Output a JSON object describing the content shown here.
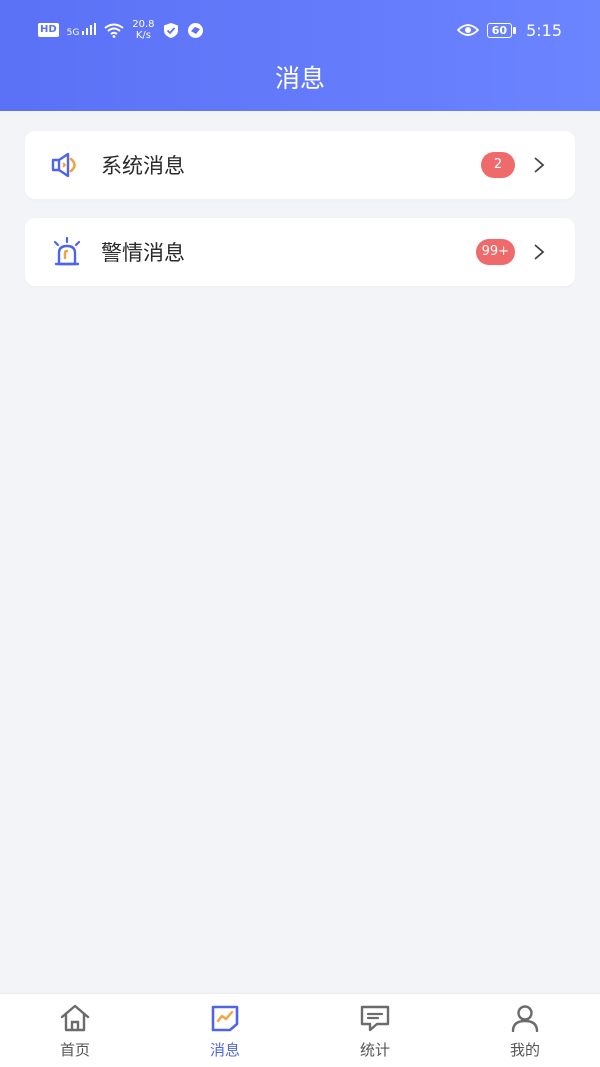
{
  "status_bar": {
    "hd": "HD",
    "signal_label": "5G",
    "net_speed_value": "20.8",
    "net_speed_unit": "K/s",
    "battery": "60",
    "time": "5:15"
  },
  "header": {
    "title": "消息"
  },
  "messages": [
    {
      "label": "系统消息",
      "badge": "2",
      "icon": "megaphone-icon"
    },
    {
      "label": "警情消息",
      "badge": "99+",
      "icon": "alarm-light-icon"
    }
  ],
  "tabbar": {
    "items": [
      {
        "label": "首页",
        "icon": "home-icon"
      },
      {
        "label": "消息",
        "icon": "message-note-icon",
        "active": true
      },
      {
        "label": "统计",
        "icon": "chat-bubble-icon"
      },
      {
        "label": "我的",
        "icon": "user-icon"
      }
    ]
  },
  "colors": {
    "accent": "#5b71f6",
    "badge": "#ef6a6a",
    "background": "#f3f4f8"
  }
}
